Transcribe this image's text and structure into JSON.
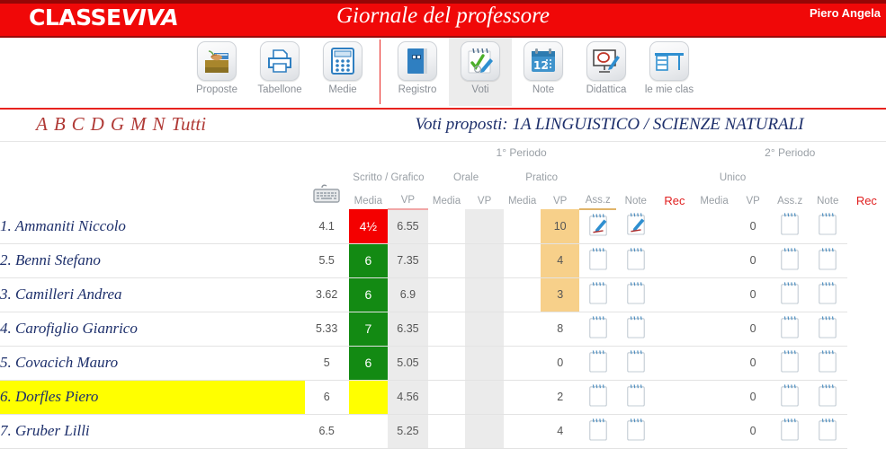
{
  "header": {
    "logo_main": "CLASSE",
    "logo_accent": "VIVA",
    "app_title": "Giornale del professore",
    "user_name": "Piero Angela",
    "bar_color": "#f00808"
  },
  "toolbar": {
    "items": [
      {
        "label": "Proposte",
        "icon": "folder-hand-icon",
        "active": false
      },
      {
        "label": "Tabellone",
        "icon": "printer-icon",
        "active": false
      },
      {
        "label": "Medie",
        "icon": "calculator-icon",
        "active": false
      },
      {
        "label": "Registro",
        "icon": "blue-book-icon",
        "active": false
      },
      {
        "label": "Voti",
        "icon": "check-pencil-icon",
        "active": true
      },
      {
        "label": "Note",
        "icon": "calendar-12-icon",
        "active": false
      },
      {
        "label": "Didattica",
        "icon": "whiteboard-at-icon",
        "active": false
      },
      {
        "label": "le mie clas",
        "icon": "desk-icon",
        "active": false
      }
    ]
  },
  "filters": {
    "letters": [
      "A",
      "B",
      "C",
      "D",
      "G",
      "M",
      "N",
      "Tutti"
    ]
  },
  "page": {
    "title": "Voti proposti: 1A LINGUISTICO / SCIENZE NATURALI",
    "keyboard_icon": "keyboard-icon"
  },
  "table": {
    "periods": [
      {
        "label": "1° Periodo"
      },
      {
        "label": "2° Periodo"
      }
    ],
    "groups_p1": [
      "Scritto / Grafico",
      "Orale",
      "Pratico"
    ],
    "groups_p2": [
      "Unico"
    ],
    "sub_media": "Media",
    "sub_vp": "VP",
    "col_assz": "Ass.z",
    "col_note": "Note",
    "col_rec": "Rec",
    "rows": [
      {
        "n": "1.",
        "name": "Ammaniti Niccolo",
        "p1": {
          "scritto_media": "4.1",
          "scritto_vp": "4½",
          "scritto_vp_state": "red",
          "orale_media": "6.55",
          "orale_vp": "",
          "pratico_media": "",
          "pratico_vp": "",
          "assz": "10",
          "assz_hot": true,
          "note_filled": true,
          "rec_filled": true
        },
        "p2": {
          "unico_media": "",
          "unico_vp": "",
          "assz": "0",
          "assz_hot": false,
          "note_filled": false,
          "rec_filled": false
        },
        "highlight": false
      },
      {
        "n": "2.",
        "name": "Benni Stefano",
        "p1": {
          "scritto_media": "5.5",
          "scritto_vp": "6",
          "scritto_vp_state": "green",
          "orale_media": "7.35",
          "orale_vp": "",
          "pratico_media": "",
          "pratico_vp": "",
          "assz": "4",
          "assz_hot": true,
          "note_filled": false,
          "rec_filled": false
        },
        "p2": {
          "unico_media": "",
          "unico_vp": "",
          "assz": "0",
          "assz_hot": false,
          "note_filled": false,
          "rec_filled": false
        },
        "highlight": false
      },
      {
        "n": "3.",
        "name": "Camilleri Andrea",
        "p1": {
          "scritto_media": "3.62",
          "scritto_vp": "6",
          "scritto_vp_state": "green",
          "orale_media": "6.9",
          "orale_vp": "",
          "pratico_media": "",
          "pratico_vp": "",
          "assz": "3",
          "assz_hot": true,
          "note_filled": false,
          "rec_filled": false
        },
        "p2": {
          "unico_media": "",
          "unico_vp": "",
          "assz": "0",
          "assz_hot": false,
          "note_filled": false,
          "rec_filled": false
        },
        "highlight": false
      },
      {
        "n": "4.",
        "name": "Carofiglio Gianrico",
        "p1": {
          "scritto_media": "5.33",
          "scritto_vp": "7",
          "scritto_vp_state": "green",
          "orale_media": "6.35",
          "orale_vp": "",
          "pratico_media": "",
          "pratico_vp": "",
          "assz": "8",
          "assz_hot": false,
          "note_filled": false,
          "rec_filled": false
        },
        "p2": {
          "unico_media": "",
          "unico_vp": "",
          "assz": "0",
          "assz_hot": false,
          "note_filled": false,
          "rec_filled": false
        },
        "highlight": false
      },
      {
        "n": "5.",
        "name": "Covacich Mauro",
        "p1": {
          "scritto_media": "5",
          "scritto_vp": "6",
          "scritto_vp_state": "green",
          "orale_media": "5.05",
          "orale_vp": "",
          "pratico_media": "",
          "pratico_vp": "",
          "assz": "0",
          "assz_hot": false,
          "note_filled": false,
          "rec_filled": false
        },
        "p2": {
          "unico_media": "",
          "unico_vp": "",
          "assz": "0",
          "assz_hot": false,
          "note_filled": false,
          "rec_filled": false
        },
        "highlight": false
      },
      {
        "n": "6.",
        "name": "Dorfles Piero",
        "p1": {
          "scritto_media": "6",
          "scritto_vp": "",
          "scritto_vp_state": "yellow",
          "orale_media": "4.56",
          "orale_vp": "",
          "pratico_media": "",
          "pratico_vp": "",
          "assz": "2",
          "assz_hot": false,
          "note_filled": false,
          "rec_filled": false
        },
        "p2": {
          "unico_media": "",
          "unico_vp": "",
          "assz": "0",
          "assz_hot": false,
          "note_filled": false,
          "rec_filled": false
        },
        "highlight": true
      },
      {
        "n": "7.",
        "name": "Gruber Lilli",
        "p1": {
          "scritto_media": "6.5",
          "scritto_vp": "",
          "scritto_vp_state": "none",
          "orale_media": "5.25",
          "orale_vp": "",
          "pratico_media": "",
          "pratico_vp": "",
          "assz": "4",
          "assz_hot": false,
          "note_filled": false,
          "rec_filled": false
        },
        "p2": {
          "unico_media": "",
          "unico_vp": "",
          "assz": "0",
          "assz_hot": false,
          "note_filled": false,
          "rec_filled": false
        },
        "highlight": false
      }
    ]
  },
  "colors": {
    "brand_red": "#f00808",
    "vp_red": "#f40000",
    "vp_green": "#138a13",
    "highlight_yellow": "#ffff00",
    "assz_orange": "#f7d08a",
    "title_navy": "#1d2f6b",
    "letter_red": "#b03a36"
  }
}
